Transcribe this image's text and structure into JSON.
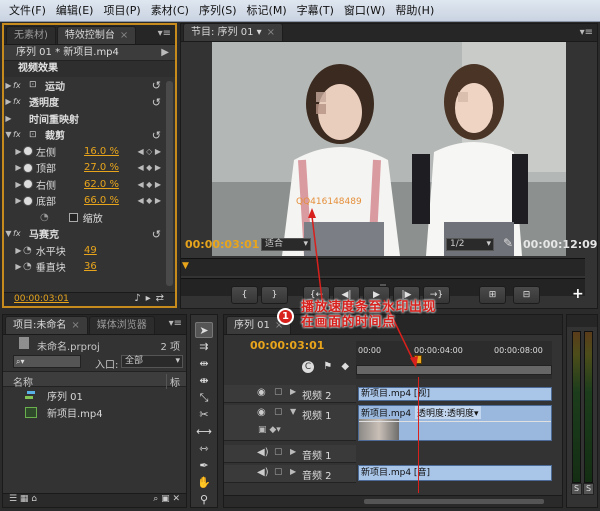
{
  "menu": [
    "文件(F)",
    "编辑(E)",
    "项目(P)",
    "素材(C)",
    "序列(S)",
    "标记(M)",
    "字幕(T)",
    "窗口(W)",
    "帮助(H)"
  ],
  "effect_controls": {
    "tab_left": "无素材)",
    "tab_active": "特效控制台",
    "clip_header": "序列 01 * 新项目.mp4",
    "section_video": "视频效果",
    "motion": "运动",
    "opacity": "透明度",
    "time_remap": "时间重映射",
    "crop": "裁剪",
    "crop_params": [
      {
        "label": "左侧",
        "value": "16.0 %"
      },
      {
        "label": "顶部",
        "value": "27.0 %"
      },
      {
        "label": "右侧",
        "value": "62.0 %"
      },
      {
        "label": "底部",
        "value": "66.0 %"
      }
    ],
    "zoom_label": "缩放",
    "mosaic": "马赛克",
    "horizontal": {
      "label": "水平块",
      "value": "49"
    },
    "vertical": {
      "label": "垂直块",
      "value": "36"
    },
    "footer_timecode": "00:00:03:01"
  },
  "program_monitor": {
    "tab": "节目: 序列 01",
    "watermark_text": "QQ416148489",
    "timecode_current": "00:00:03:01",
    "fit_label": "适合",
    "resolution": "1/2",
    "timecode_duration": "00:00:12:09",
    "buttons": [
      "{",
      "}",
      "{←",
      "◀|",
      "▶",
      "|▶",
      "→}",
      "⊞",
      "⊟",
      "+"
    ]
  },
  "project_panel": {
    "tab_active": "项目:未命名",
    "tab_media": "媒体浏览器",
    "project_file": "未命名.prproj",
    "item_count": "2 项",
    "entry_label": "入口:",
    "entry_value": "全部",
    "column_name": "名称",
    "column_tag": "标",
    "items": [
      {
        "name": "序列 01",
        "type": "sequence"
      },
      {
        "name": "新项目.mp4",
        "type": "clip"
      }
    ]
  },
  "timeline": {
    "tab": "序列 01",
    "timecode": "00:00:03:01",
    "ruler": [
      "00:00",
      "00:00:04:00",
      "00:00:08:00"
    ],
    "tracks": [
      {
        "name": "视频 2",
        "clip": "新项目.mp4 [视]"
      },
      {
        "name": "视频 1",
        "clip": "新项目.mp4",
        "clip_effect": "透明度:透明度▾"
      },
      {
        "name": "音频 1",
        "clip": ""
      },
      {
        "name": "音频 2",
        "clip": "新项目.mp4 [音]"
      }
    ]
  },
  "annotation": {
    "number": "1",
    "line1": "播放速度条至水印出现",
    "line2": "在画面的时间点",
    "color": "#d8201c"
  },
  "meter": {
    "buttons": [
      "S",
      "S"
    ]
  },
  "colors": {
    "accent_timecode": "#e8a51c",
    "annotation_red": "#d8201c",
    "highlight_border": "#c78a1c"
  }
}
